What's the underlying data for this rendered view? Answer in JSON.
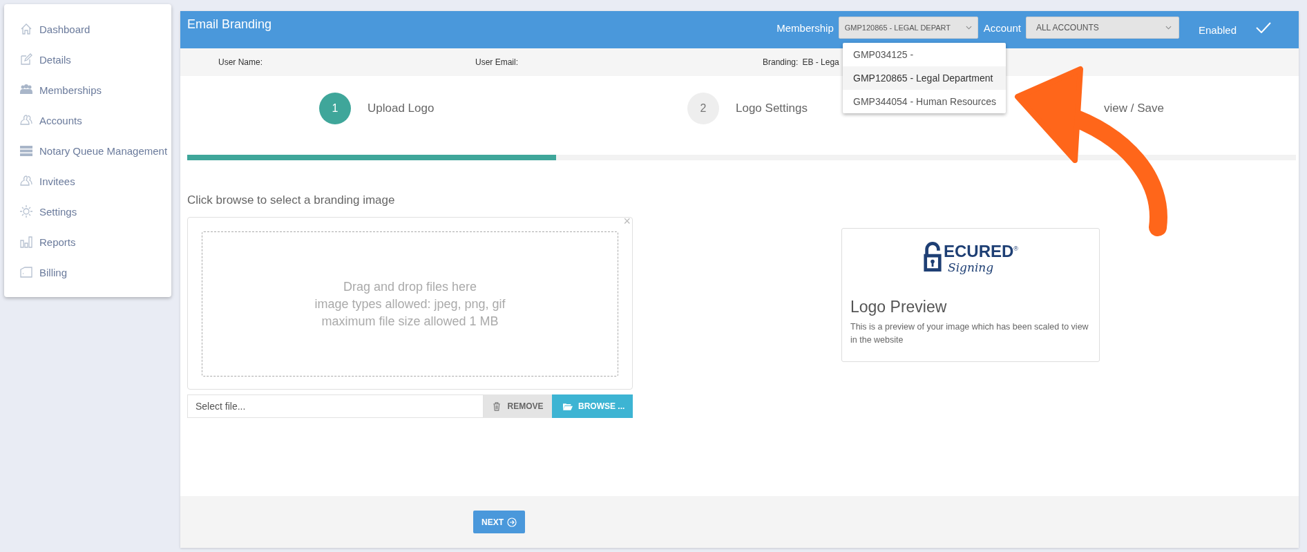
{
  "sidebar": {
    "items": [
      {
        "label": "Dashboard"
      },
      {
        "label": "Details"
      },
      {
        "label": "Memberships"
      },
      {
        "label": "Accounts"
      },
      {
        "label": "Notary Queue Management"
      },
      {
        "label": "Invitees"
      },
      {
        "label": "Settings"
      },
      {
        "label": "Reports"
      },
      {
        "label": "Billing"
      }
    ]
  },
  "header": {
    "title": "Email Branding",
    "membership_label": "Membership",
    "membership_value": "GMP120865 - LEGAL DEPART",
    "account_label": "Account",
    "account_value": "ALL ACCOUNTS",
    "enabled_label": "Enabled",
    "enabled": true
  },
  "membership_menu": [
    {
      "label": "GMP034125 -",
      "selected": false
    },
    {
      "label": "GMP120865 - Legal Department",
      "selected": true
    },
    {
      "label": "GMP344054 - Human Resources",
      "selected": false
    }
  ],
  "info_bar": {
    "user_name_label": "User Name:",
    "user_email_label": "User Email:",
    "branding_label": "Branding:",
    "branding_value": "EB - Lega"
  },
  "steps": [
    {
      "number": "1",
      "label": "Upload Logo",
      "selected": true
    },
    {
      "number": "2",
      "label": "Logo Settings",
      "selected": false
    },
    {
      "label": "view / Save",
      "selected": false
    }
  ],
  "progress": {
    "level": 0.333
  },
  "upload": {
    "instruction": "Click browse to select a branding image",
    "close": "×",
    "drop_lines": [
      "Drag and drop files here",
      "image types allowed: jpeg, png, gif",
      "maximum file size allowed 1 MB"
    ],
    "file_placeholder": "Select file...",
    "remove_label": "REMOVE",
    "browse_label": "BROWSE ..."
  },
  "preview": {
    "logo_word": "ECURED",
    "logo_script": "Signing",
    "logo_mark": "®",
    "title": "Logo Preview",
    "description": "This is a preview of your image which has been scaled to view in the website"
  },
  "footer": {
    "next_label": "NEXT"
  }
}
